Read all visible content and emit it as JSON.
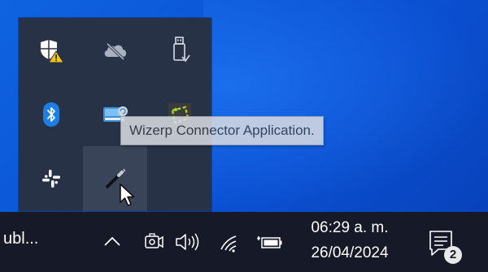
{
  "tray_flyout": {
    "items": [
      {
        "icon": "windows-security-warning-icon",
        "row": 1,
        "col": 1
      },
      {
        "icon": "onedrive-icon",
        "row": 1,
        "col": 2
      },
      {
        "icon": "usb-safely-remove-icon",
        "row": 1,
        "col": 3
      },
      {
        "icon": "bluetooth-icon",
        "row": 2,
        "col": 1
      },
      {
        "icon": "network-drive-icon",
        "row": 2,
        "col": 2
      },
      {
        "icon": "wizerp-connector-icon",
        "row": 2,
        "col": 3
      },
      {
        "icon": "slack-icon",
        "row": 3,
        "col": 1
      },
      {
        "icon": "wand-tool-icon",
        "row": 3,
        "col": 2,
        "hovered": true
      }
    ]
  },
  "tooltip": {
    "text": "Wizerp Connector Application."
  },
  "taskbar": {
    "app_label": "ubl...",
    "icons": [
      "chevron-up-icon",
      "meet-now-camera-icon",
      "volume-icon",
      "wifi-icon",
      "battery-icon"
    ],
    "clock": {
      "time": "06:29 a. m.",
      "date": "26/04/2024"
    },
    "notifications": {
      "count": "2"
    }
  },
  "colors": {
    "flyout_bg": "#283246",
    "taskbar_bg": "#161a28",
    "desktop_blue": "#0a55d8",
    "bluetooth_blue": "#1b7fe6"
  }
}
